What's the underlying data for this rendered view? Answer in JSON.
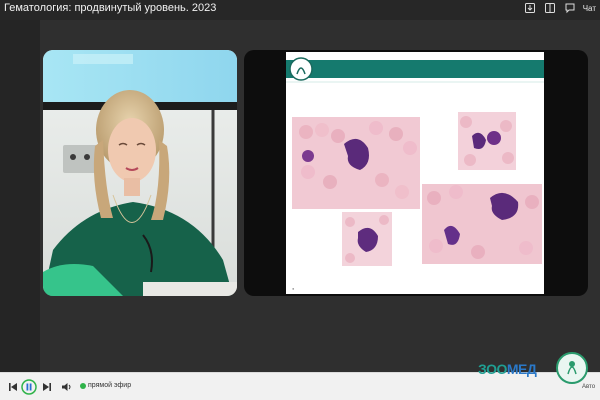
{
  "header": {
    "title": "Гематология: продвинутый уровень. 2023",
    "chat_label": "Чат",
    "icons": [
      "import-icon",
      "layout-icon",
      "chat-icon"
    ]
  },
  "player": {
    "live_label": "прямой эфир",
    "icons": [
      "skip-back-icon",
      "pause-icon",
      "skip-forward-icon",
      "volume-icon"
    ],
    "accent_color": "#2fb34a"
  },
  "brand": {
    "logo_text_main": "ЗОО",
    "logo_text_accent": "МЕД",
    "emblem_label": "Авто"
  },
  "colors": {
    "slide_header": "#157a6e",
    "background": "#2d2d2d",
    "bottom_bar": "#f1f1f1"
  }
}
